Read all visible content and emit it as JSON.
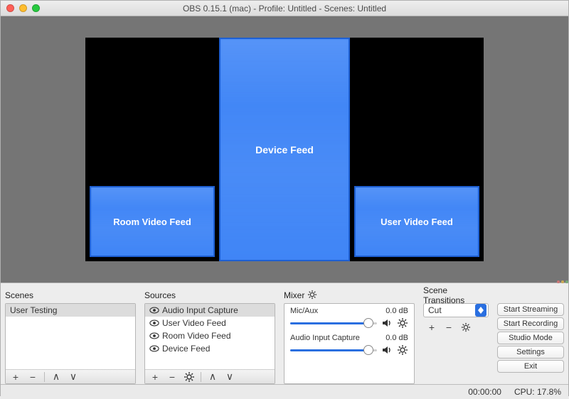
{
  "window": {
    "title": "OBS 0.15.1 (mac) - Profile: Untitled - Scenes: Untitled"
  },
  "preview": {
    "feeds": {
      "device": "Device Feed",
      "room": "Room Video Feed",
      "user": "User Video Feed"
    }
  },
  "panels": {
    "scenes": {
      "label": "Scenes",
      "items": [
        "User Testing"
      ],
      "selected": 0
    },
    "sources": {
      "label": "Sources",
      "items": [
        "Audio Input Capture",
        "User Video Feed",
        "Room Video Feed",
        "Device Feed"
      ],
      "selected": 0
    },
    "mixer": {
      "label": "Mixer",
      "channels": [
        {
          "name": "Mic/Aux",
          "db": "0.0 dB",
          "pos": 0.9
        },
        {
          "name": "Audio Input Capture",
          "db": "0.0 dB",
          "pos": 0.9
        }
      ]
    },
    "transitions": {
      "label": "Scene Transitions",
      "selected": "Cut"
    },
    "buttons": {
      "start_streaming": "Start Streaming",
      "start_recording": "Start Recording",
      "studio_mode": "Studio Mode",
      "settings": "Settings",
      "exit": "Exit"
    }
  },
  "status": {
    "time": "00:00:00",
    "cpu": "CPU: 17.8%"
  },
  "icons": {
    "plus": "+",
    "minus": "−",
    "up": "∧",
    "down": "∨",
    "gear": "gear"
  }
}
